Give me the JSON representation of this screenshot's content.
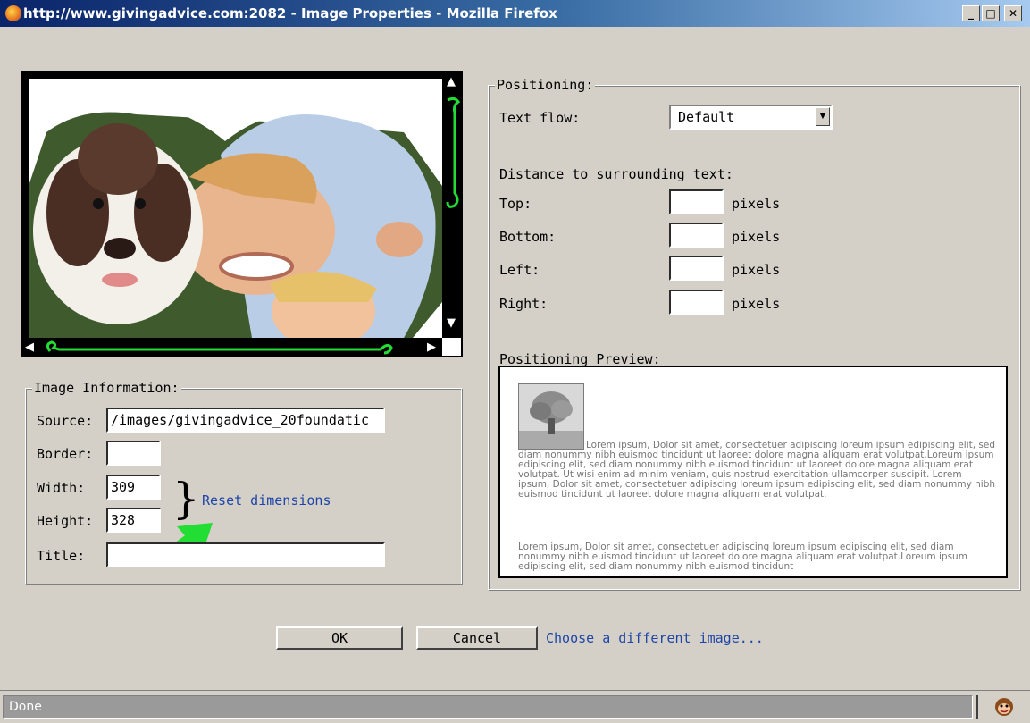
{
  "window": {
    "title": "http://www.givingadvice.com:2082 - Image Properties - Mozilla Firefox",
    "minimize_symbol": "_",
    "maximize_symbol": "□",
    "close_symbol": "✕"
  },
  "preview": {
    "scroll_up": "▲",
    "scroll_down": "▼",
    "scroll_left": "◀",
    "scroll_right": "▶"
  },
  "image_info": {
    "legend": "Image Information:",
    "source_label": "Source:",
    "source_value": "/images/givingadvice_20foundatic",
    "border_label": "Border:",
    "border_value": "",
    "width_label": "Width:",
    "width_value": "309",
    "height_label": "Height:",
    "height_value": "328",
    "brace": "}",
    "reset_link": "Reset dimensions",
    "title_label": "Title:",
    "title_value": ""
  },
  "positioning": {
    "legend": "Positioning:",
    "text_flow_label": "Text flow:",
    "text_flow_value": "Default",
    "distance_heading": "Distance to surrounding text:",
    "rows": [
      {
        "label": "Top:",
        "unit": "pixels",
        "value": ""
      },
      {
        "label": "Bottom:",
        "unit": "pixels",
        "value": ""
      },
      {
        "label": "Left:",
        "unit": "pixels",
        "value": ""
      },
      {
        "label": "Right:",
        "unit": "pixels",
        "value": ""
      }
    ],
    "preview_heading": "Positioning Preview:",
    "lorem_1": "Lorem ipsum, Dolor sit amet, consectetuer adipiscing loreum ipsum edipiscing elit, sed diam nonummy nibh euismod tincidunt ut laoreet dolore magna aliquam erat volutpat.Loreum ipsum edipiscing elit, sed diam nonummy nibh euismod tincidunt ut laoreet dolore magna aliquam erat volutpat. Ut wisi enim ad minim veniam, quis nostrud exercitation ullamcorper suscipit. Lorem ipsum, Dolor sit amet, consectetuer adipiscing loreum ipsum edipiscing elit, sed diam nonummy nibh euismod tincidunt ut laoreet dolore magna aliquam erat volutpat.",
    "lorem_2": "Lorem ipsum, Dolor sit amet, consectetuer adipiscing loreum ipsum edipiscing elit, sed diam nonummy nibh euismod tincidunt ut laoreet dolore magna aliquam erat volutpat.Loreum ipsum edipiscing elit, sed diam nonummy nibh euismod tincidunt"
  },
  "buttons": {
    "ok": "OK",
    "cancel": "Cancel",
    "choose_link": "Choose a different image..."
  },
  "status": {
    "text": "Done"
  },
  "colors": {
    "accent_green": "#22dd33",
    "link_blue": "#1f45a8"
  }
}
